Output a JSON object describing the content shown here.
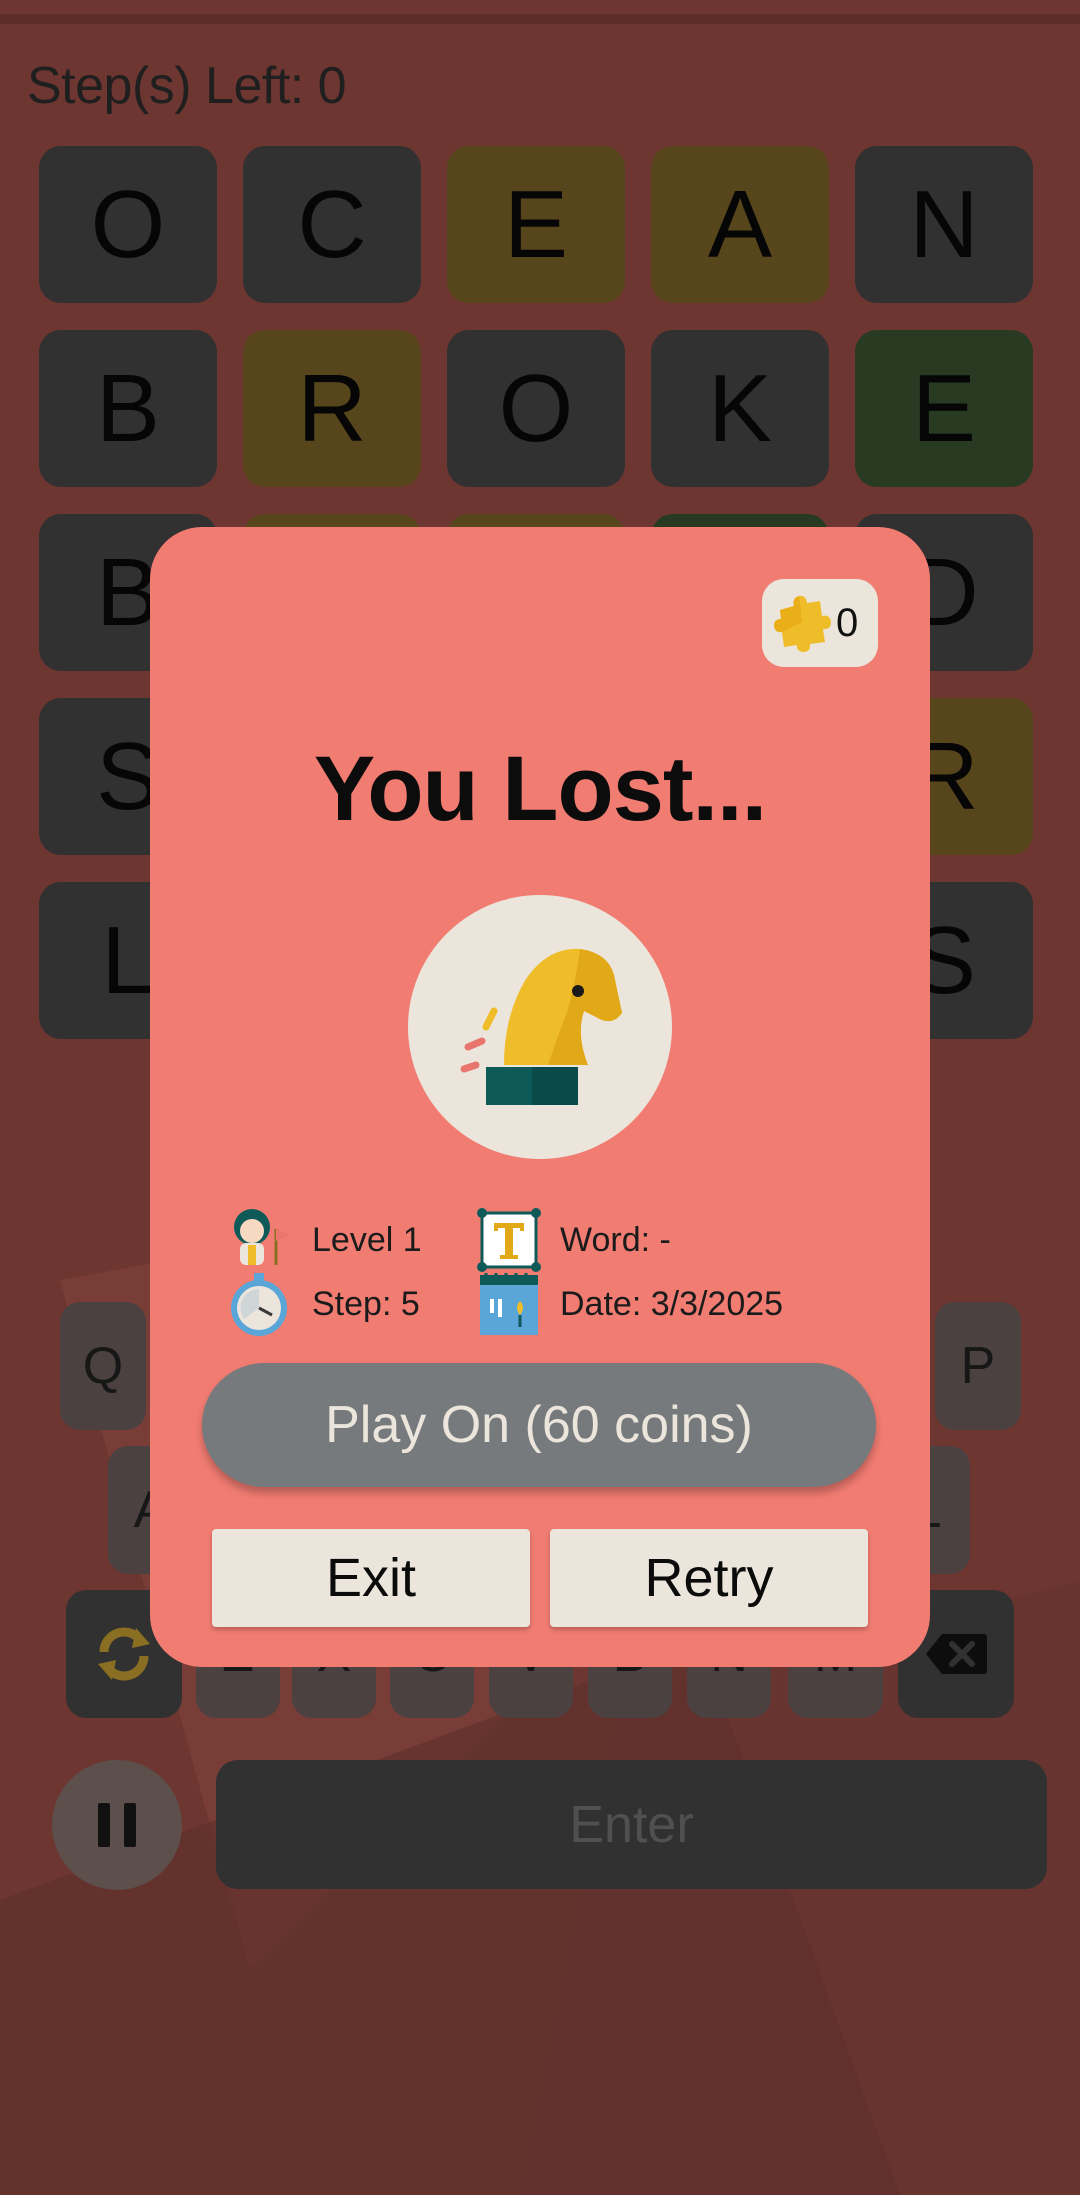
{
  "status": {
    "steps_left": "Step(s) Left: 0"
  },
  "board": {
    "rows": [
      [
        {
          "l": "O",
          "s": "absent"
        },
        {
          "l": "C",
          "s": "absent"
        },
        {
          "l": "E",
          "s": "present"
        },
        {
          "l": "A",
          "s": "present"
        },
        {
          "l": "N",
          "s": "absent"
        }
      ],
      [
        {
          "l": "B",
          "s": "absent"
        },
        {
          "l": "R",
          "s": "present"
        },
        {
          "l": "O",
          "s": "absent"
        },
        {
          "l": "K",
          "s": "absent"
        },
        {
          "l": "E",
          "s": "correct"
        }
      ],
      [
        {
          "l": "B",
          "s": "absent"
        },
        {
          "l": "",
          "s": "absent"
        },
        {
          "l": "",
          "s": "absent"
        },
        {
          "l": "",
          "s": "absent"
        },
        {
          "l": "D",
          "s": "absent"
        }
      ],
      [
        {
          "l": "S",
          "s": "absent"
        },
        {
          "l": "",
          "s": "absent"
        },
        {
          "l": "",
          "s": "absent"
        },
        {
          "l": "",
          "s": "absent"
        },
        {
          "l": "R",
          "s": "present"
        }
      ],
      [
        {
          "l": "L",
          "s": "absent"
        },
        {
          "l": "",
          "s": "absent"
        },
        {
          "l": "",
          "s": "absent"
        },
        {
          "l": "",
          "s": "absent"
        },
        {
          "l": "S",
          "s": "absent"
        }
      ]
    ]
  },
  "keyboard": {
    "row1_left": "Q",
    "row1_right": "P",
    "row2_left": "A",
    "row2_right": "L",
    "row3": [
      "Z",
      "X",
      "C",
      "V",
      "B",
      "N",
      "M"
    ],
    "enter_label": "Enter"
  },
  "dialog": {
    "coin_count": "0",
    "title": "You Lost...",
    "level": "Level 1",
    "step": "Step: 5",
    "word": "Word: -",
    "date": "Date: 3/3/2025",
    "play_on_label": "Play On (60 coins)",
    "exit_label": "Exit",
    "retry_label": "Retry"
  },
  "colors": {
    "dialog_bg": "#f17c72",
    "cream": "#ebe5dc",
    "tile_absent": "#323131",
    "tile_present": "#57461c",
    "tile_correct": "#283a22",
    "button_gray": "#767a7d",
    "accent_yellow": "#f0bd2a",
    "accent_teal": "#0e5a58"
  },
  "icons": [
    "puzzle-piece-icon",
    "knight-chess-icon",
    "person-flag-icon",
    "stopwatch-icon",
    "letter-t-icon",
    "calendar-icon",
    "refresh-icon",
    "backspace-icon",
    "pause-icon"
  ]
}
